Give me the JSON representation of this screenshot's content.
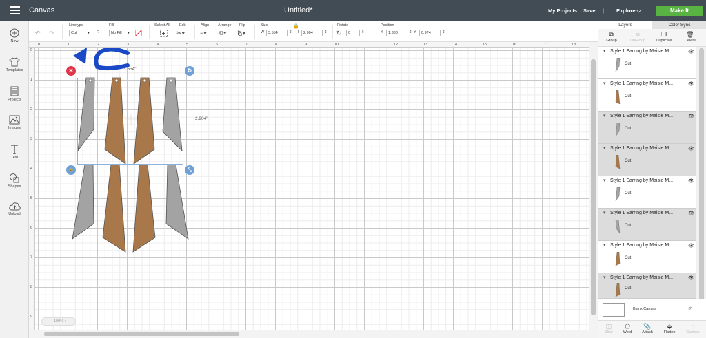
{
  "topbar": {
    "app_title": "Canvas",
    "doc_title": "Untitled*",
    "my_projects": "My Projects",
    "save": "Save",
    "separator": "|",
    "explore": "Explore",
    "make_it": "Make It"
  },
  "leftbar": {
    "items": [
      {
        "label": "New",
        "icon": "plus-icon"
      },
      {
        "label": "Templates",
        "icon": "shirt-icon"
      },
      {
        "label": "Projects",
        "icon": "projects-icon"
      },
      {
        "label": "Images",
        "icon": "image-icon"
      },
      {
        "label": "Text",
        "icon": "text-icon"
      },
      {
        "label": "Shapes",
        "icon": "shapes-icon"
      },
      {
        "label": "Upload",
        "icon": "upload-icon"
      }
    ]
  },
  "toolbar": {
    "linetype_label": "Linetype",
    "linetype_value": "Cut",
    "help": "?",
    "fill_label": "Fill",
    "fill_value": "No Fill",
    "select_all_label": "Select All",
    "edit_label": "Edit",
    "align_label": "Align",
    "arrange_label": "Arrange",
    "flip_label": "Flip",
    "size_label": "Size",
    "w_label": "W",
    "w_value": "3.554",
    "h_label": "H",
    "h_value": "2.904",
    "rotate_label": "Rotate",
    "rotate_value": "0",
    "position_label": "Position",
    "x_label": "X",
    "x_value": "1.388",
    "y_label": "Y",
    "y_value": "0.974"
  },
  "canvas": {
    "ruler_top": [
      "0",
      "1",
      "2",
      "3",
      "4",
      "5",
      "6",
      "7",
      "8",
      "9",
      "10",
      "11",
      "12",
      "13",
      "14",
      "15",
      "16",
      "17",
      "18"
    ],
    "ruler_left": [
      "0",
      "1",
      "2",
      "3",
      "4",
      "5",
      "6",
      "7",
      "8",
      "9"
    ],
    "width_label": "3.554\"",
    "height_label": "2.904\"",
    "zoom": "100%"
  },
  "rightpanel": {
    "tabs": [
      "Layers",
      "Color Sync"
    ],
    "actions": [
      {
        "label": "Group",
        "enabled": true
      },
      {
        "label": "UnGroup",
        "enabled": false
      },
      {
        "label": "Duplicate",
        "enabled": true
      },
      {
        "label": "Delete",
        "enabled": true
      }
    ],
    "layers": [
      {
        "title": "Style 1 Earring by Maisie M...",
        "sub": "Cut",
        "color": "#a3a3a3",
        "grey": false
      },
      {
        "title": "Style 1 Earring by Maisie M...",
        "sub": "Cut",
        "color": "#a8784a",
        "grey": false
      },
      {
        "title": "Style 1 Earring by Maisie M...",
        "sub": "Cut",
        "color": "#a3a3a3",
        "grey": true
      },
      {
        "title": "Style 1 Earring by Maisie M...",
        "sub": "Cut",
        "color": "#a8784a",
        "grey": true
      },
      {
        "title": "Style 1 Earring by Maisie M...",
        "sub": "Cut",
        "color": "#a3a3a3",
        "grey": false
      },
      {
        "title": "Style 1 Earring by Maisie M...",
        "sub": "Cut",
        "color": "#a3a3a3",
        "grey": true
      },
      {
        "title": "Style 1 Earring by Maisie M...",
        "sub": "Cut",
        "color": "#a8784a",
        "grey": false
      },
      {
        "title": "Style 1 Earring by Maisie M...",
        "sub": "Cut",
        "color": "#a8784a",
        "grey": true
      }
    ],
    "blank_canvas": "Blank Canvas",
    "bottom_actions": [
      {
        "label": "Slice",
        "enabled": false
      },
      {
        "label": "Weld",
        "enabled": true
      },
      {
        "label": "Attach",
        "enabled": true
      },
      {
        "label": "Flatten",
        "enabled": true
      },
      {
        "label": "Contour",
        "enabled": false
      }
    ]
  },
  "colors": {
    "topbar": "#414c55",
    "make_it": "#58b342",
    "grey_piece": "#a3a3a3",
    "brown_piece": "#a8784a",
    "annotation_arrow": "#1a49c7",
    "delete_handle": "#e0364a",
    "blue_handle": "#6fa0d8"
  }
}
